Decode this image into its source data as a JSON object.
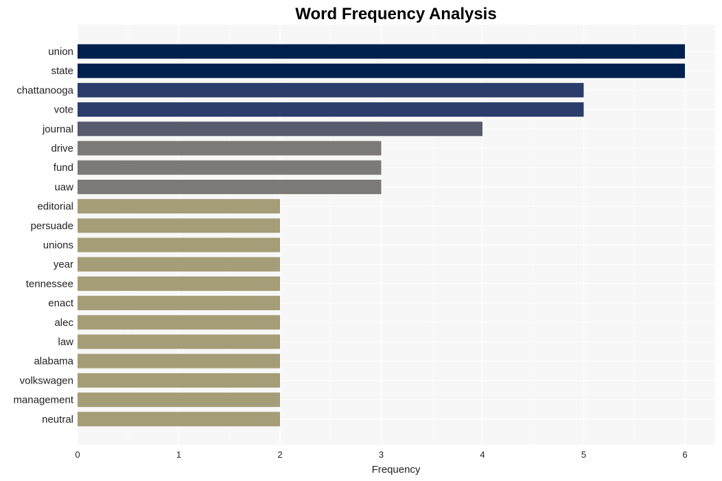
{
  "chart_data": {
    "type": "bar",
    "orientation": "horizontal",
    "title": "Word Frequency Analysis",
    "xlabel": "Frequency",
    "ylabel": "",
    "xlim": [
      0,
      6.3
    ],
    "xticks": [
      0,
      1,
      2,
      3,
      4,
      5,
      6
    ],
    "grid": true,
    "legend": "none",
    "categories": [
      "union",
      "state",
      "chattanooga",
      "vote",
      "journal",
      "drive",
      "fund",
      "uaw",
      "editorial",
      "persuade",
      "unions",
      "year",
      "tennessee",
      "enact",
      "alec",
      "law",
      "alabama",
      "volkswagen",
      "management",
      "neutral"
    ],
    "values": [
      6,
      6,
      5,
      5,
      4,
      3,
      3,
      3,
      2,
      2,
      2,
      2,
      2,
      2,
      2,
      2,
      2,
      2,
      2,
      2
    ],
    "colors_by_value": {
      "6": "#00204e",
      "5": "#2b3d6b",
      "4": "#575b6d",
      "3": "#7b7a76",
      "2": "#a59d77"
    },
    "background": "#f7f7f7"
  }
}
